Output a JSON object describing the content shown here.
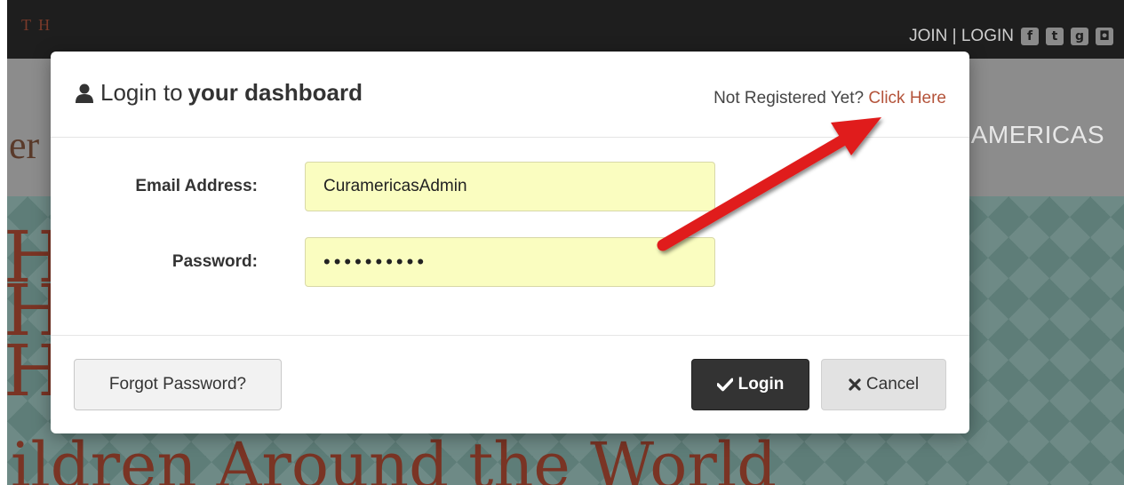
{
  "site": {
    "brand_fragment": "T H",
    "top_links": "JOIN | LOGIN",
    "social_icons": [
      "facebook-icon",
      "twitter-icon",
      "googleplus-icon",
      "instagram-icon"
    ],
    "nav_item": "AMERICAS",
    "nav_left_fragment": "er",
    "hero_letters": [
      "H",
      "H",
      "H"
    ],
    "hero_title": "ildren Around the World"
  },
  "modal": {
    "title_prefix": "Login to ",
    "title_bold": "your dashboard",
    "register_prompt": "Not Registered Yet? ",
    "register_link": "Click Here",
    "email_label": "Email Address:",
    "email_value": "CuramericasAdmin",
    "password_label": "Password:",
    "password_value": "••••••••••",
    "forgot_button": "Forgot Password?",
    "login_button": "Login",
    "cancel_button": "Cancel"
  },
  "colors": {
    "link": "#b4533a",
    "input_bg": "#fafdc0",
    "login_btn": "#333333",
    "arrow": "#e01b1b"
  }
}
